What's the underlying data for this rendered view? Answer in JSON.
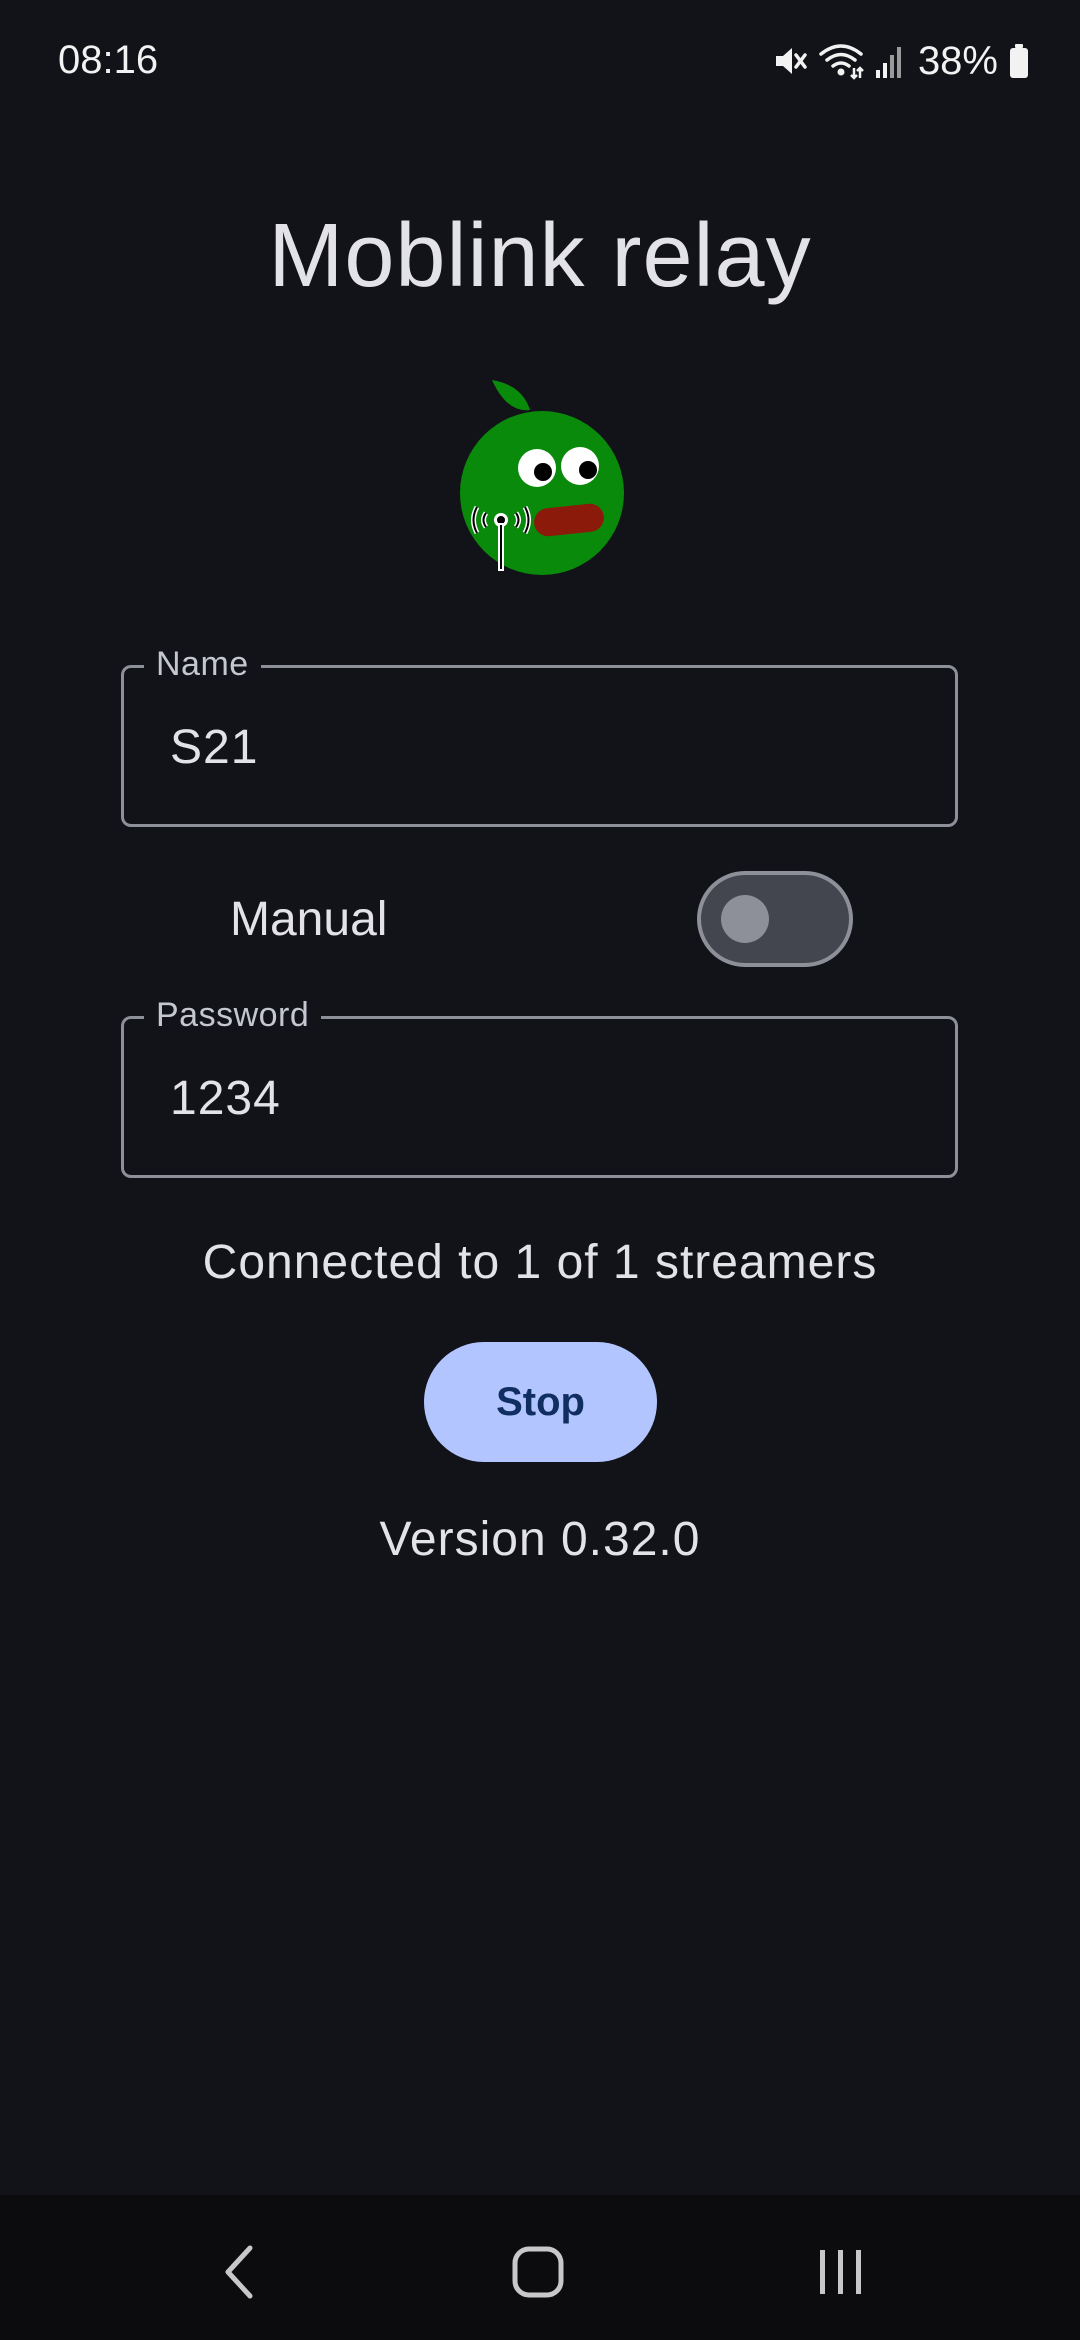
{
  "status_bar": {
    "time": "08:16",
    "battery": "38%",
    "icons": [
      "mute-icon",
      "wifi-icon",
      "signal-icon",
      "battery-icon"
    ]
  },
  "app": {
    "title": "Moblink relay",
    "logo_icon": "moblink-logo-icon"
  },
  "name_field": {
    "label": "Name",
    "value": "S21"
  },
  "manual": {
    "label": "Manual",
    "enabled": false
  },
  "password_field": {
    "label": "Password",
    "value": "1234"
  },
  "status": {
    "text": "Connected to 1 of 1 streamers"
  },
  "stop_button": {
    "label": "Stop"
  },
  "version": {
    "text": "Version 0.32.0"
  },
  "nav_bar": {
    "icons": [
      "back-icon",
      "home-icon",
      "recents-icon"
    ]
  },
  "colors": {
    "background": "#121318",
    "primary_container": "#b3c5ff",
    "on_primary_container": "#102f60",
    "outline": "#8e9099",
    "logo_green": "#0a8a0a",
    "logo_mouth": "#8b1a0a"
  }
}
